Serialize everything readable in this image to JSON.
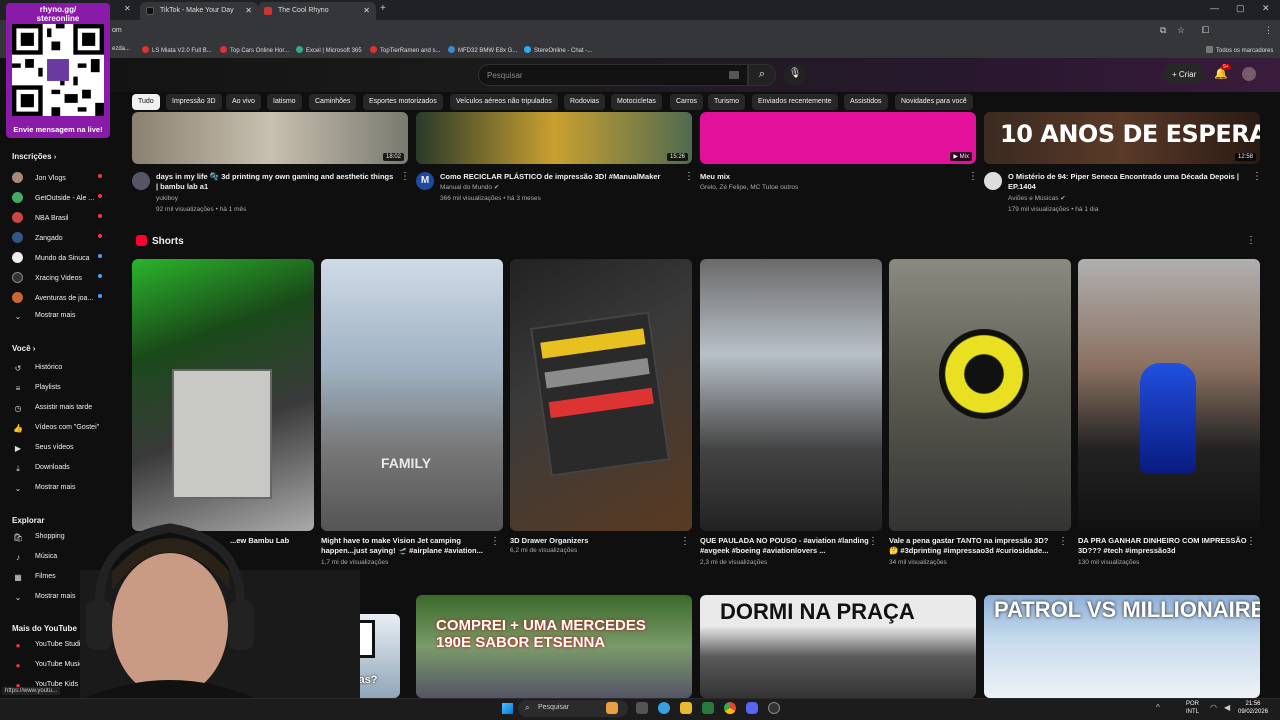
{
  "browser": {
    "tabs": [
      {
        "label": "TikTok - Make Your Day"
      },
      {
        "label": "The Cool Rhyno"
      }
    ],
    "address_fragment": "om",
    "bookmarks": [
      "ezda...",
      "LS Miata V2.0 Full B...",
      "Top Cars Online Hor...",
      "Excel | Microsoft 365",
      "TopTierRamen and s...",
      "MFD32 BMW E8x G...",
      "StereOnline - Chat -..."
    ],
    "bookmarks_folder": "Todos os marcadores"
  },
  "overlay": {
    "handle": "rhyno.gg/",
    "handle2": "stereonline",
    "cta": "Envie mensagem na live!"
  },
  "header": {
    "search_placeholder": "Pesquisar",
    "create_label": "Criar",
    "notif_count": "9+"
  },
  "chips": [
    "Tudo",
    "Impressão 3D",
    "Ao vivo",
    "Iatismo",
    "Caminhões",
    "Esportes motorizados",
    "Veículos aéreos não tripulados",
    "Rodovias",
    "Motocicletas",
    "Carros",
    "Turismo",
    "Enviados recentemente",
    "Assistidos",
    "Novidades para você"
  ],
  "sidebar": {
    "subs_heading": "Inscrições",
    "subs": [
      "Jon Vlogs",
      "GetOutside - Ale ...",
      "NBA Brasil",
      "Zangado",
      "Mundo da Sinuca",
      "Xracing Videos",
      "Aventuras de joa..."
    ],
    "subs_more": "Mostrar mais",
    "you_heading": "Você",
    "you_items": [
      "Histórico",
      "Playlists",
      "Assistir mais tarde",
      "Vídeos com \"Gostei\"",
      "Seus vídeos",
      "Downloads",
      "Mostrar mais"
    ],
    "explore_heading": "Explorar",
    "explore_items": [
      "Shopping",
      "Música",
      "Filmes",
      "Mostrar mais"
    ],
    "more_heading": "Mais do YouTube",
    "more_items": [
      "YouTube Studio",
      "YouTube Music",
      "YouTube Kids"
    ]
  },
  "videos_top": [
    {
      "title": "days in my life 🫧 3d printing my own gaming and aesthetic things | bambu lab a1",
      "channel": "yukiboy",
      "meta": "92 mil visualizações • há 1 mês",
      "duration": "18:02"
    },
    {
      "title": "Como RECICLAR PLÁSTICO de impressão 3D! #ManualMaker",
      "channel": "Manual do Mundo",
      "meta": "366 mil visualizações • há 3 meses",
      "duration": "15:26"
    },
    {
      "title": "Meu mix",
      "channel": "Grelo, Zé Felipe, MC Tutoe outros",
      "meta": "",
      "duration": "Mix"
    },
    {
      "title": "O Mistério de 94: Piper Seneca Encontrado uma Década Depois | EP.1404",
      "channel": "Aviões e Músicas",
      "meta": "179 mil visualizações • há 1 dia",
      "duration": "12:58",
      "thumb_text": "10 ANOS DE ESPERA"
    }
  ],
  "shorts": {
    "heading": "Shorts",
    "items": [
      {
        "title": "...ew Bambu Lab",
        "views": ""
      },
      {
        "title": "Might have to make Vision Jet camping happen...just saying! 🛫 #airplane #aviation...",
        "views": "1,7 mi de visualizações",
        "overlay": "FAMILY"
      },
      {
        "title": "3D Drawer Organizers",
        "views": "6,2 mi de visualizações"
      },
      {
        "title": "QUE PAULADA NO POUSO - #aviation #landing #avgeek #boeing #aviationlovers ...",
        "views": "2,3 mi de visualizações"
      },
      {
        "title": "Vale a pena gastar TANTO na impressão 3D? 🤔 #3dprinting #impressao3d #curiosidade...",
        "views": "34 mil visualizações"
      },
      {
        "title": "DA PRA GANHAR DINHEIRO COM IMPRESSÃO 3D??? #tech #impressão3d",
        "views": "130 mil visualizações"
      }
    ]
  },
  "videos_bottom": [
    {
      "thumb_text": "Perguntas?"
    },
    {
      "thumb_text": "COMPREI + UMA MERCEDES 190E SABOR ETSENNA"
    },
    {
      "thumb_text": "DORMI NA PRAÇA"
    },
    {
      "thumb_text": "PATROL VS MILLIONAIRES!"
    }
  ],
  "taskbar": {
    "search": "Pesquisar",
    "lang": "POR",
    "lang2": "INTL",
    "time": "21:56",
    "date": "09/02/2026"
  },
  "statusbar": "https://www.youtu..."
}
